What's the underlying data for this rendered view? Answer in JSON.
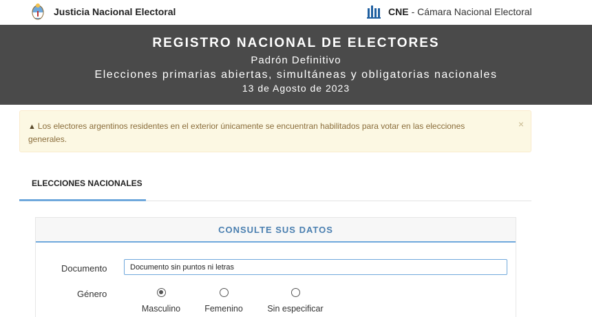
{
  "header": {
    "left_title": "Justicia Nacional Electoral",
    "right_bold": "CNE",
    "right_rest": "- Cámara Nacional Electoral"
  },
  "banner": {
    "title": "REGISTRO NACIONAL DE ELECTORES",
    "subtitle": "Padrón Definitivo",
    "election": "Elecciones primarias abiertas, simultáneas y obligatorias nacionales",
    "date": "13 de Agosto de 2023"
  },
  "alert": {
    "text": "Los electores argentinos residentes en el exterior únicamente se encuentran habilitados para votar en las elecciones generales.",
    "close_symbol": "×"
  },
  "tabs": [
    {
      "label": "ELECCIONES NACIONALES",
      "active": true
    }
  ],
  "form": {
    "title": "CONSULTE SUS DATOS",
    "documento_label": "Documento",
    "documento_placeholder": "Documento sin puntos ni letras",
    "documento_value": "",
    "genero_label": "Género",
    "genero_options": [
      {
        "label": "Masculino",
        "checked": true
      },
      {
        "label": "Femenino",
        "checked": false
      },
      {
        "label": "Sin especificar",
        "checked": false
      }
    ]
  },
  "colors": {
    "banner_bg": "#4a4a4a",
    "accent": "#6fa8dc",
    "alert_bg": "#fcf8e3",
    "alert_text": "#8a6d3b"
  },
  "icons": {
    "escudo": "argentina-coat-of-arms-icon",
    "cne": "cne-building-icon",
    "warning": "warning-triangle-icon",
    "close": "close-icon"
  }
}
